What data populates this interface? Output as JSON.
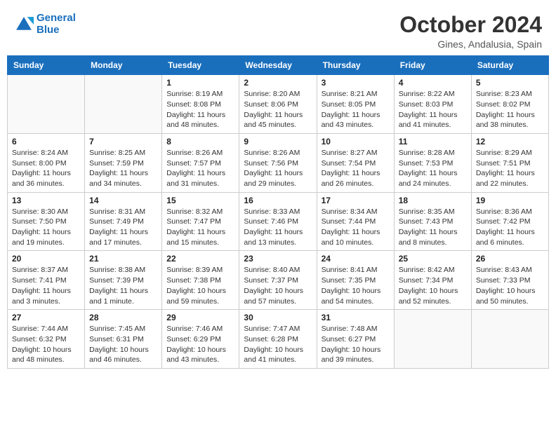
{
  "header": {
    "logo_line1": "General",
    "logo_line2": "Blue",
    "title": "October 2024",
    "subtitle": "Gines, Andalusia, Spain"
  },
  "days_of_week": [
    "Sunday",
    "Monday",
    "Tuesday",
    "Wednesday",
    "Thursday",
    "Friday",
    "Saturday"
  ],
  "weeks": [
    [
      {
        "day": "",
        "info": ""
      },
      {
        "day": "",
        "info": ""
      },
      {
        "day": "1",
        "info": "Sunrise: 8:19 AM\nSunset: 8:08 PM\nDaylight: 11 hours and 48 minutes."
      },
      {
        "day": "2",
        "info": "Sunrise: 8:20 AM\nSunset: 8:06 PM\nDaylight: 11 hours and 45 minutes."
      },
      {
        "day": "3",
        "info": "Sunrise: 8:21 AM\nSunset: 8:05 PM\nDaylight: 11 hours and 43 minutes."
      },
      {
        "day": "4",
        "info": "Sunrise: 8:22 AM\nSunset: 8:03 PM\nDaylight: 11 hours and 41 minutes."
      },
      {
        "day": "5",
        "info": "Sunrise: 8:23 AM\nSunset: 8:02 PM\nDaylight: 11 hours and 38 minutes."
      }
    ],
    [
      {
        "day": "6",
        "info": "Sunrise: 8:24 AM\nSunset: 8:00 PM\nDaylight: 11 hours and 36 minutes."
      },
      {
        "day": "7",
        "info": "Sunrise: 8:25 AM\nSunset: 7:59 PM\nDaylight: 11 hours and 34 minutes."
      },
      {
        "day": "8",
        "info": "Sunrise: 8:26 AM\nSunset: 7:57 PM\nDaylight: 11 hours and 31 minutes."
      },
      {
        "day": "9",
        "info": "Sunrise: 8:26 AM\nSunset: 7:56 PM\nDaylight: 11 hours and 29 minutes."
      },
      {
        "day": "10",
        "info": "Sunrise: 8:27 AM\nSunset: 7:54 PM\nDaylight: 11 hours and 26 minutes."
      },
      {
        "day": "11",
        "info": "Sunrise: 8:28 AM\nSunset: 7:53 PM\nDaylight: 11 hours and 24 minutes."
      },
      {
        "day": "12",
        "info": "Sunrise: 8:29 AM\nSunset: 7:51 PM\nDaylight: 11 hours and 22 minutes."
      }
    ],
    [
      {
        "day": "13",
        "info": "Sunrise: 8:30 AM\nSunset: 7:50 PM\nDaylight: 11 hours and 19 minutes."
      },
      {
        "day": "14",
        "info": "Sunrise: 8:31 AM\nSunset: 7:49 PM\nDaylight: 11 hours and 17 minutes."
      },
      {
        "day": "15",
        "info": "Sunrise: 8:32 AM\nSunset: 7:47 PM\nDaylight: 11 hours and 15 minutes."
      },
      {
        "day": "16",
        "info": "Sunrise: 8:33 AM\nSunset: 7:46 PM\nDaylight: 11 hours and 13 minutes."
      },
      {
        "day": "17",
        "info": "Sunrise: 8:34 AM\nSunset: 7:44 PM\nDaylight: 11 hours and 10 minutes."
      },
      {
        "day": "18",
        "info": "Sunrise: 8:35 AM\nSunset: 7:43 PM\nDaylight: 11 hours and 8 minutes."
      },
      {
        "day": "19",
        "info": "Sunrise: 8:36 AM\nSunset: 7:42 PM\nDaylight: 11 hours and 6 minutes."
      }
    ],
    [
      {
        "day": "20",
        "info": "Sunrise: 8:37 AM\nSunset: 7:41 PM\nDaylight: 11 hours and 3 minutes."
      },
      {
        "day": "21",
        "info": "Sunrise: 8:38 AM\nSunset: 7:39 PM\nDaylight: 11 hours and 1 minute."
      },
      {
        "day": "22",
        "info": "Sunrise: 8:39 AM\nSunset: 7:38 PM\nDaylight: 10 hours and 59 minutes."
      },
      {
        "day": "23",
        "info": "Sunrise: 8:40 AM\nSunset: 7:37 PM\nDaylight: 10 hours and 57 minutes."
      },
      {
        "day": "24",
        "info": "Sunrise: 8:41 AM\nSunset: 7:35 PM\nDaylight: 10 hours and 54 minutes."
      },
      {
        "day": "25",
        "info": "Sunrise: 8:42 AM\nSunset: 7:34 PM\nDaylight: 10 hours and 52 minutes."
      },
      {
        "day": "26",
        "info": "Sunrise: 8:43 AM\nSunset: 7:33 PM\nDaylight: 10 hours and 50 minutes."
      }
    ],
    [
      {
        "day": "27",
        "info": "Sunrise: 7:44 AM\nSunset: 6:32 PM\nDaylight: 10 hours and 48 minutes."
      },
      {
        "day": "28",
        "info": "Sunrise: 7:45 AM\nSunset: 6:31 PM\nDaylight: 10 hours and 46 minutes."
      },
      {
        "day": "29",
        "info": "Sunrise: 7:46 AM\nSunset: 6:29 PM\nDaylight: 10 hours and 43 minutes."
      },
      {
        "day": "30",
        "info": "Sunrise: 7:47 AM\nSunset: 6:28 PM\nDaylight: 10 hours and 41 minutes."
      },
      {
        "day": "31",
        "info": "Sunrise: 7:48 AM\nSunset: 6:27 PM\nDaylight: 10 hours and 39 minutes."
      },
      {
        "day": "",
        "info": ""
      },
      {
        "day": "",
        "info": ""
      }
    ]
  ],
  "colors": {
    "header_bg": "#1a6fbd",
    "header_text": "#ffffff",
    "border": "#cccccc",
    "empty_bg": "#f9f9f9"
  }
}
